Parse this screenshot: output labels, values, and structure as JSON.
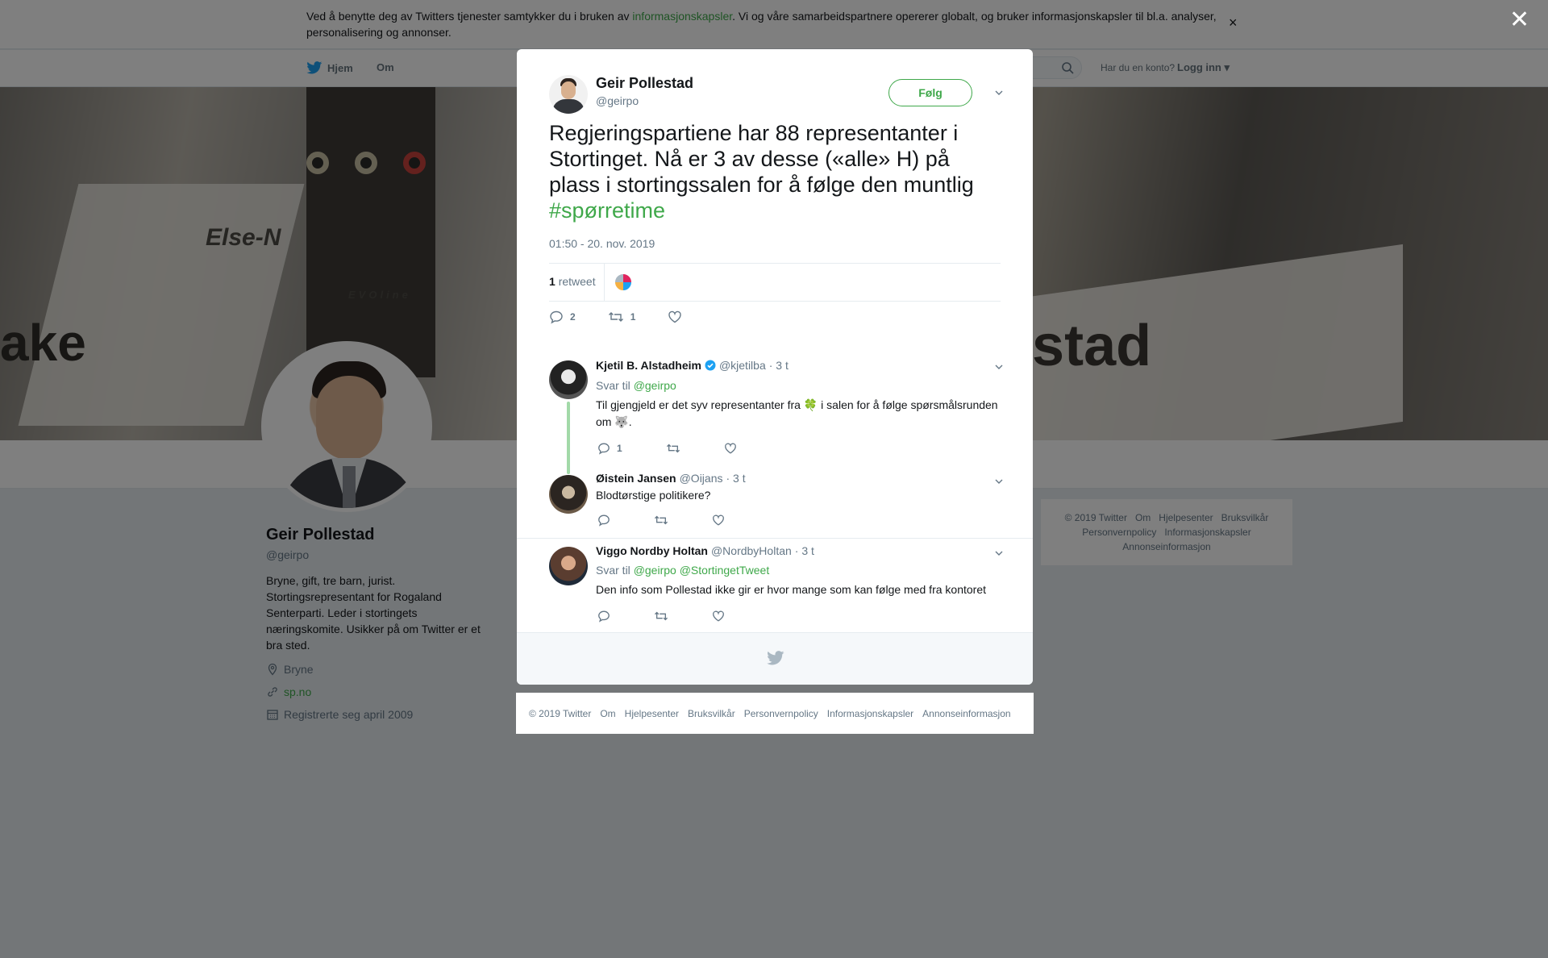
{
  "cookie": {
    "text_before": "Ved å benytte deg av Twitters tjenester samtykker du i bruken av ",
    "link": "informasjonskapsler",
    "text_after": ". Vi og våre samarbeidspartnere opererer globalt, og bruker informasjonskapsler til bl.a. analyser, personalisering og annonser.",
    "close": "×"
  },
  "nav": {
    "home": "Hjem",
    "about": "Om",
    "login_question": "Har du en konto?",
    "login": "Logg inn"
  },
  "banner": {
    "text_left": "Else-N",
    "text_brand": "EVOline",
    "text_big_left": "ake",
    "text_big_right": "estad"
  },
  "profile": {
    "name": "Geir Pollestad",
    "handle": "@geirpo",
    "bio": "Bryne, gift, tre barn, jurist. Stortingsrepresentant for Rogaland Senterparti. Leder i stortingets næringskomite. Usikker på om Twitter er et bra sted.",
    "location": "Bryne",
    "website": "sp.no",
    "joined": "Registrerte seg april 2009"
  },
  "side_footer": [
    "© 2019 Twitter",
    "Om",
    "Hjelpesenter",
    "Bruksvilkår",
    "Personvernpolicy",
    "Informasjonskapsler",
    "Annonseinformasjon"
  ],
  "overlay_close": "✕",
  "tweet": {
    "author_name": "Geir Pollestad",
    "author_handle": "@geirpo",
    "follow_label": "Følg",
    "text": "Regjeringspartiene har 88 representanter i Stortinget. Nå er 3 av desse («alle» H) på plass i stortingssalen for å følge den muntlig ",
    "hashtag": "#spørretime",
    "time": "01:50 - 20. nov. 2019",
    "retweet_count": "1",
    "retweet_label": "retweet",
    "reply_count": "2",
    "rt_action_count": "1"
  },
  "replies": [
    {
      "name": "Kjetil B. Alstadheim",
      "verified": true,
      "handle": "@kjetilba",
      "time": "· 3 t",
      "reply_to_label": "Svar til",
      "reply_to": "@geirpo",
      "text_a": "Til gjengjeld er det syv representanter fra ",
      "emoji_a": "🍀",
      "text_b": " i salen for å følge spørsmålsrunden om ",
      "emoji_b": "🐺",
      "text_c": ".",
      "reply_count": "1"
    },
    {
      "name": "Øistein Jansen",
      "handle": "@Oijans",
      "time": "· 3 t",
      "text": "Blodtørstige politikere?"
    },
    {
      "name": "Viggo Nordby Holtan",
      "handle": "@NordbyHoltan",
      "time": "· 3 t",
      "reply_to_label": "Svar til",
      "reply_to": "@geirpo",
      "reply_to_2": "@StortingetTweet",
      "text": "Den info som Pollestad ikke gir er hvor mange som kan følge med fra kontoret"
    }
  ],
  "bottom_footer": [
    "© 2019 Twitter",
    "Om",
    "Hjelpesenter",
    "Bruksvilkår",
    "Personvernpolicy",
    "Informasjonskapsler",
    "Annonseinformasjon"
  ],
  "colors": {
    "accent": "#3fa84a",
    "muted": "#657786",
    "verified": "#1da1f2"
  }
}
